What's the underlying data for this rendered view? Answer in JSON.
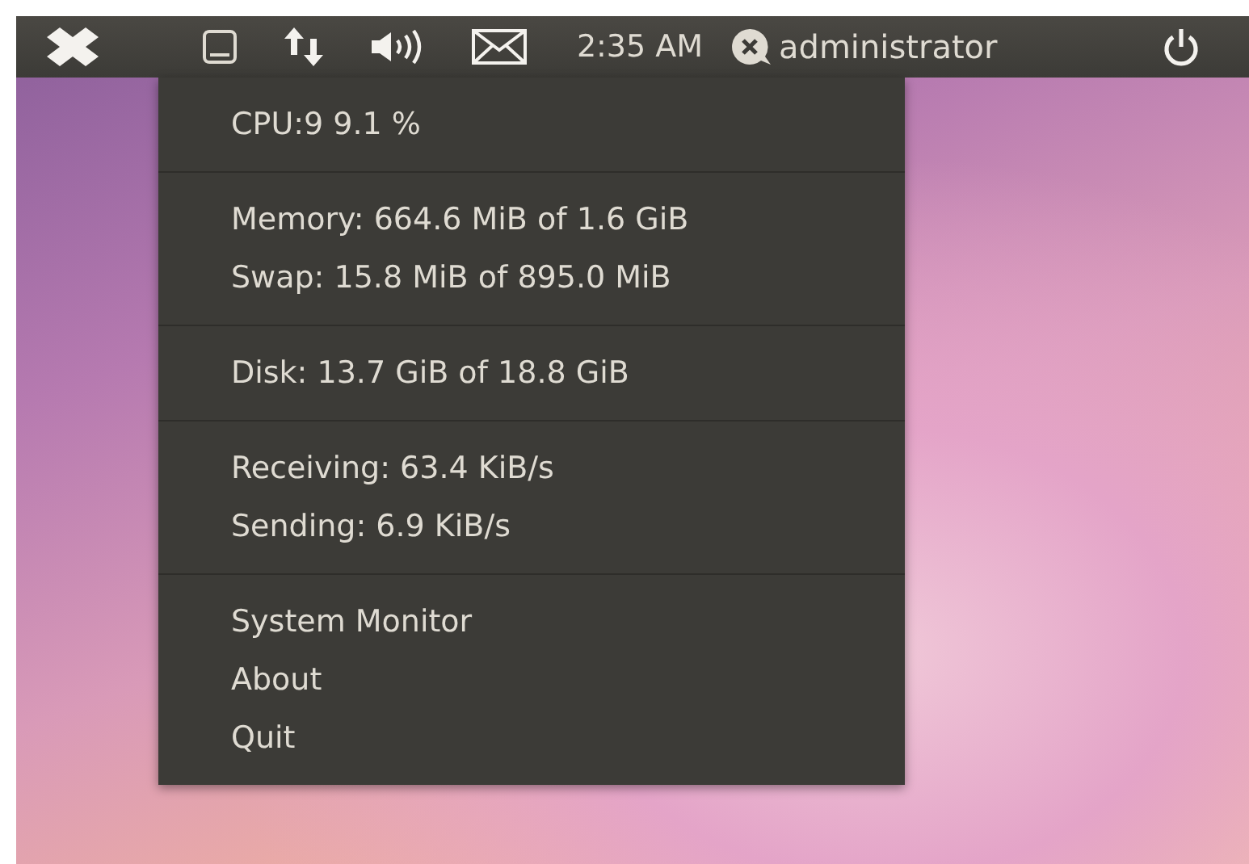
{
  "panel": {
    "clock": "2:35 AM",
    "user": "administrator"
  },
  "menu": {
    "sections": [
      {
        "lines": [
          "CPU:9 9.1 %"
        ]
      },
      {
        "lines": [
          "Memory: 664.6 MiB of 1.6 GiB",
          "Swap: 15.8 MiB of 895.0 MiB"
        ]
      },
      {
        "lines": [
          "Disk: 13.7 GiB of 18.8 GiB"
        ]
      },
      {
        "lines": [
          "Receiving: 63.4 KiB/s",
          "Sending: 6.9 KiB/s"
        ]
      }
    ],
    "actions": [
      "System Monitor",
      "About",
      "Quit"
    ]
  }
}
